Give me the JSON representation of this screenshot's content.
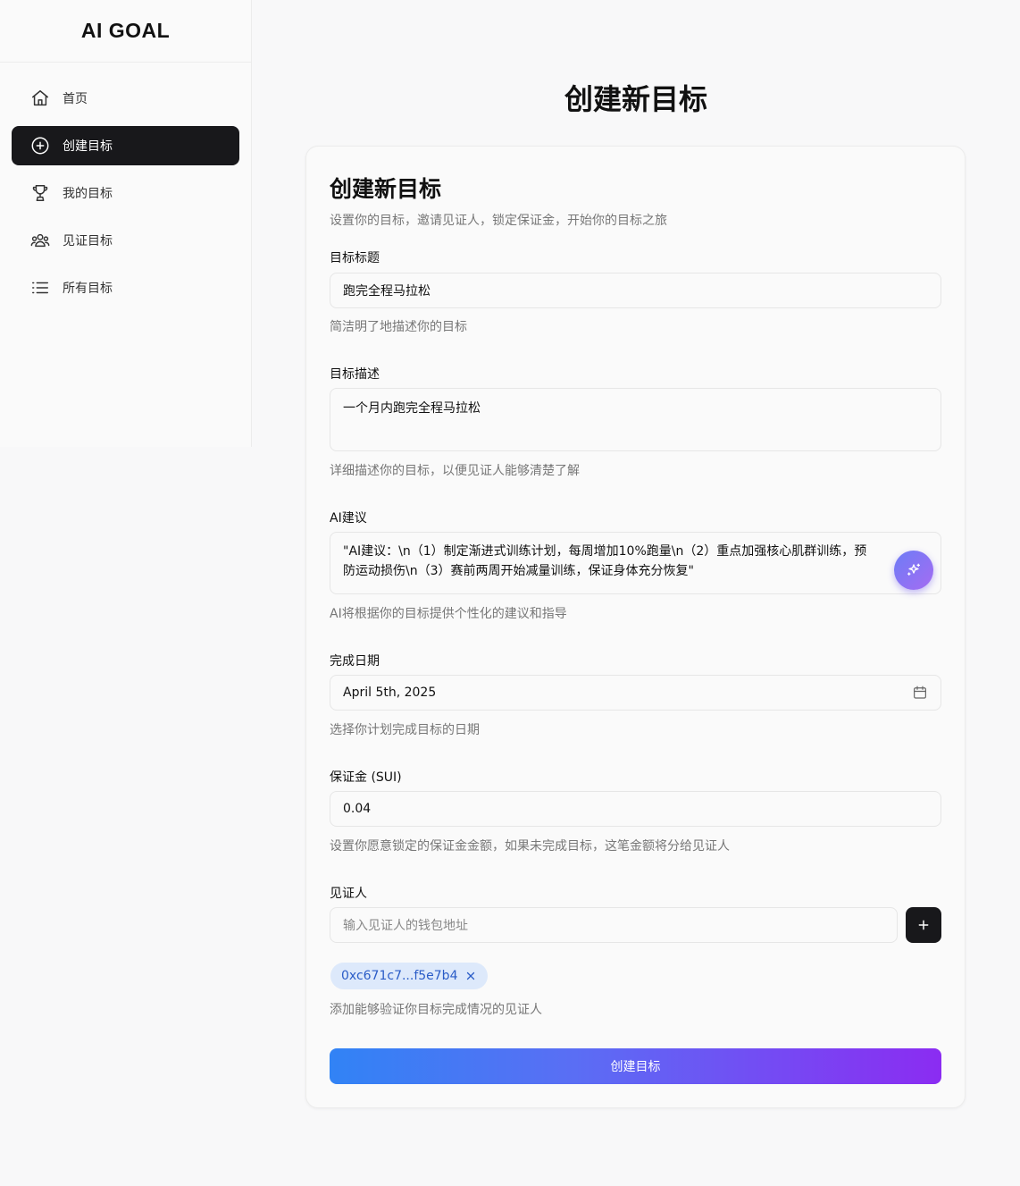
{
  "brand": "AI GOAL",
  "nav": [
    {
      "label": "首页",
      "icon": "home-icon",
      "active": false
    },
    {
      "label": "创建目标",
      "icon": "plus-circle-icon",
      "active": true
    },
    {
      "label": "我的目标",
      "icon": "trophy-icon",
      "active": false
    },
    {
      "label": "见证目标",
      "icon": "users-icon",
      "active": false
    },
    {
      "label": "所有目标",
      "icon": "list-icon",
      "active": false
    }
  ],
  "page_title": "创建新目标",
  "card": {
    "title": "创建新目标",
    "subtitle": "设置你的目标，邀请见证人，锁定保证金，开始你的目标之旅",
    "goal_title": {
      "label": "目标标题",
      "value": "跑完全程马拉松",
      "help": "简洁明了地描述你的目标"
    },
    "goal_desc": {
      "label": "目标描述",
      "value": "一个月内跑完全程马拉松",
      "help": "详细描述你的目标，以便见证人能够清楚了解"
    },
    "ai": {
      "label": "AI建议",
      "value": "\"AI建议：\\n（1）制定渐进式训练计划，每周增加10%跑量\\n（2）重点加强核心肌群训练，预防运动损伤\\n（3）赛前两周开始减量训练，保证身体充分恢复\"",
      "help": "AI将根据你的目标提供个性化的建议和指导"
    },
    "date": {
      "label": "完成日期",
      "value": "April 5th, 2025",
      "help": "选择你计划完成目标的日期"
    },
    "deposit": {
      "label": "保证金 (SUI)",
      "value": "0.04",
      "help": "设置你愿意锁定的保证金金额，如果未完成目标，这笔金额将分给见证人"
    },
    "witness": {
      "label": "见证人",
      "placeholder": "输入见证人的钱包地址",
      "chips": [
        "0xc671c7...f5e7b4"
      ],
      "help": "添加能够验证你目标完成情况的见证人"
    },
    "submit_label": "创建目标"
  },
  "colors": {
    "active_nav_bg": "#18181b",
    "chip_bg": "#dde9fb",
    "chip_text": "#2a5cc7",
    "gradient_start": "#3183f5",
    "gradient_end": "#8b2cf2"
  }
}
